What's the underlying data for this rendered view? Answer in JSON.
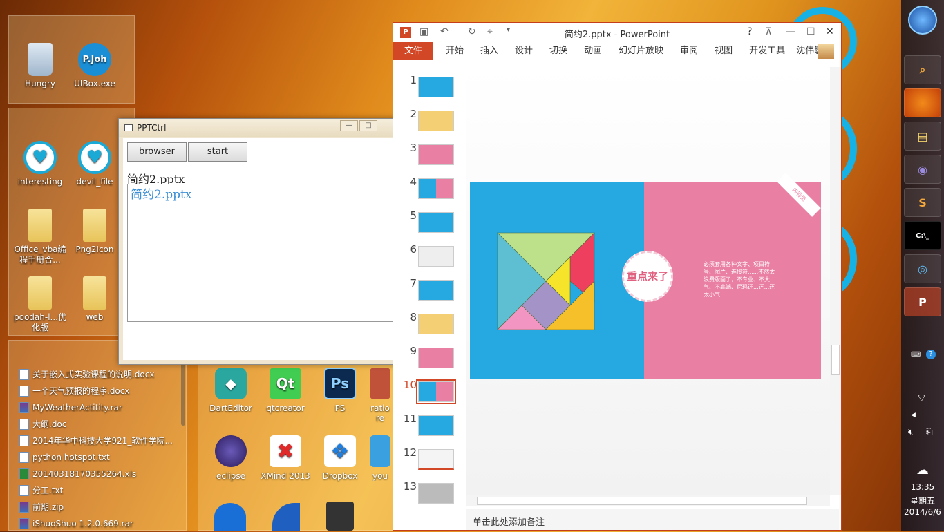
{
  "desktop": {
    "group1": [
      {
        "label": "Hungry",
        "icon": "recycle-bin-icon"
      },
      {
        "label": "UIBox.exe",
        "icon": "uibox-icon"
      }
    ],
    "group2": [
      {
        "label": "interesting",
        "icon": "heart-icon"
      },
      {
        "label": "devil_file",
        "icon": "heart-icon"
      },
      {
        "label": "Office_vba编程手册合...",
        "icon": "folder-icon"
      },
      {
        "label": "Png2Icon",
        "icon": "folder-icon"
      },
      {
        "label": "poodah-l...优化版",
        "icon": "folder-icon"
      },
      {
        "label": "web",
        "icon": "folder-icon"
      }
    ],
    "files": [
      {
        "label": "关于嵌入式实验课程的说明.docx",
        "type": "doc"
      },
      {
        "label": "一个天气预报的程序.docx",
        "type": "doc"
      },
      {
        "label": "MyWeatherActitity.rar",
        "type": "rar"
      },
      {
        "label": "大纲.doc",
        "type": "doc"
      },
      {
        "label": "2014年华中科技大学921_软件学院...",
        "type": "doc"
      },
      {
        "label": "python hotspot.txt",
        "type": "txt"
      },
      {
        "label": "20140318170355264.xls",
        "type": "xls"
      },
      {
        "label": "分工.txt",
        "type": "txt"
      },
      {
        "label": "前期.zip",
        "type": "rar"
      },
      {
        "label": "iShuoShuo 1.2.0.669.rar",
        "type": "rar"
      }
    ],
    "apps": [
      {
        "label": "DartEditor",
        "glyph": "◆",
        "color": "#2aa8a0"
      },
      {
        "label": "qtcreator",
        "glyph": "Qt",
        "color": "#41cd52"
      },
      {
        "label": "PS",
        "glyph": "Ps",
        "color": "#0c2a4f"
      },
      {
        "label": "ratio re",
        "glyph": "",
        "color": "#c0523a"
      },
      {
        "label": "eclipse",
        "glyph": "",
        "color": "#3a2a7a"
      },
      {
        "label": "XMind 2013",
        "glyph": "✖",
        "color": "#e02a2a"
      },
      {
        "label": "Dropbox",
        "glyph": "❖",
        "color": "#ffffff"
      },
      {
        "label": "you",
        "glyph": "",
        "color": "#3aa0e0"
      }
    ]
  },
  "pptctrl": {
    "title": "PPTCtrl",
    "browser": "browser",
    "start": "start",
    "label": "简约2.pptx",
    "field": "简约2.pptx"
  },
  "ppt": {
    "title": "简约2.pptx - PowerPoint",
    "help": "?",
    "tabs": [
      "文件",
      "开始",
      "插入",
      "设计",
      "切换",
      "动画",
      "幻灯片放映",
      "审阅",
      "视图",
      "开发工具"
    ],
    "user": "沈伟敏",
    "slides": [
      "1",
      "2",
      "3",
      "4",
      "5",
      "6",
      "7",
      "8",
      "9",
      "10",
      "11",
      "12",
      "13"
    ],
    "selected": "10",
    "slide": {
      "badge": "重点来了",
      "text": "必须套用各种文字、项目符号、图片、连接符......不然太浪费版面了，不专业、不大气、不高端、尼玛还...还...还太小气",
      "tag": "内容页"
    },
    "notes": "单击此处添加备注"
  },
  "taskbar": {
    "time": "13:35",
    "weekday": "星期五",
    "date": "2014/6/6"
  }
}
